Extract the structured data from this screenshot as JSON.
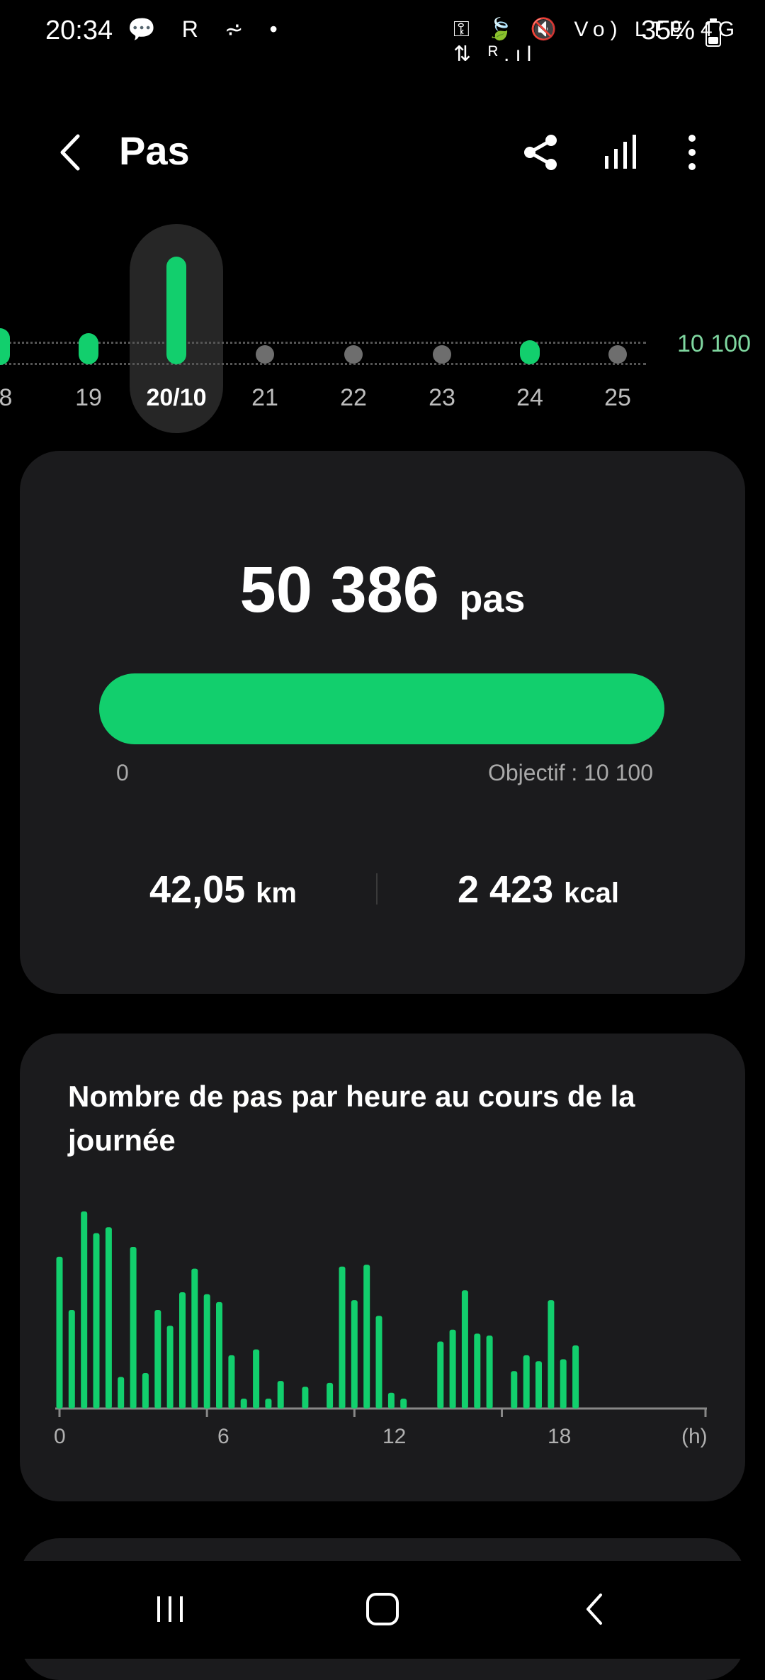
{
  "status_bar": {
    "time": "20:34",
    "left_icons_text": "💬 R ⩫ •",
    "right_icons_text": "⚿ 🍃 🔇 Vo) LTE 4G ⇅ ᴿ.ıl",
    "battery_pct": "35%"
  },
  "app_bar": {
    "title": "Pas",
    "icons": [
      "back-icon",
      "share-icon",
      "bar-chart-icon",
      "more-vertical-icon"
    ]
  },
  "week_strip": {
    "goal_label": "10 100",
    "days": [
      {
        "label": "8",
        "ratio": 0.3
      },
      {
        "label": "19",
        "ratio": 0.2
      },
      {
        "label": "20/10",
        "ratio": 1.0,
        "selected": true
      },
      {
        "label": "21",
        "ratio": 0
      },
      {
        "label": "22",
        "ratio": 0
      },
      {
        "label": "23",
        "ratio": 0
      },
      {
        "label": "24",
        "ratio": 0.15
      },
      {
        "label": "25",
        "ratio": 0
      }
    ]
  },
  "summary": {
    "steps_value": "50 386",
    "steps_unit": "pas",
    "progress_start": "0",
    "progress_goal": "Objectif : 10 100",
    "distance_value": "42,05",
    "distance_unit": "km",
    "calories_value": "2 423",
    "calories_unit": "kcal"
  },
  "hourly_chart": {
    "title": "Nombre de pas par heure au cours de la journée",
    "x_ticks": [
      "0",
      "6",
      "12",
      "18"
    ],
    "unit_label": "(h)"
  },
  "chart_data": {
    "type": "bar",
    "title": "Nombre de pas par heure au cours de la journée",
    "xlabel": "(h)",
    "x_ticks": [
      "0",
      "6",
      "12",
      "18"
    ],
    "xlim": [
      0,
      24
    ],
    "bars": [
      {
        "x": 0.0,
        "v": 0.77
      },
      {
        "x": 0.5,
        "v": 0.5
      },
      {
        "x": 1.0,
        "v": 1.0
      },
      {
        "x": 1.5,
        "v": 0.89
      },
      {
        "x": 2.0,
        "v": 0.92
      },
      {
        "x": 2.5,
        "v": 0.16
      },
      {
        "x": 3.0,
        "v": 0.82
      },
      {
        "x": 3.5,
        "v": 0.18
      },
      {
        "x": 4.0,
        "v": 0.5
      },
      {
        "x": 4.5,
        "v": 0.42
      },
      {
        "x": 5.0,
        "v": 0.59
      },
      {
        "x": 5.5,
        "v": 0.71
      },
      {
        "x": 6.0,
        "v": 0.58
      },
      {
        "x": 6.5,
        "v": 0.54
      },
      {
        "x": 7.0,
        "v": 0.27
      },
      {
        "x": 7.5,
        "v": 0.05
      },
      {
        "x": 8.0,
        "v": 0.3
      },
      {
        "x": 8.5,
        "v": 0.05
      },
      {
        "x": 9.0,
        "v": 0.14
      },
      {
        "x": 10.0,
        "v": 0.11
      },
      {
        "x": 11.0,
        "v": 0.13
      },
      {
        "x": 11.5,
        "v": 0.72
      },
      {
        "x": 12.0,
        "v": 0.55
      },
      {
        "x": 12.5,
        "v": 0.73
      },
      {
        "x": 13.0,
        "v": 0.47
      },
      {
        "x": 13.5,
        "v": 0.08
      },
      {
        "x": 14.0,
        "v": 0.05
      },
      {
        "x": 15.5,
        "v": 0.34
      },
      {
        "x": 16.0,
        "v": 0.4
      },
      {
        "x": 16.5,
        "v": 0.6
      },
      {
        "x": 17.0,
        "v": 0.38
      },
      {
        "x": 17.5,
        "v": 0.37
      },
      {
        "x": 18.5,
        "v": 0.19
      },
      {
        "x": 19.0,
        "v": 0.27
      },
      {
        "x": 19.5,
        "v": 0.24
      },
      {
        "x": 20.0,
        "v": 0.55
      },
      {
        "x": 20.5,
        "v": 0.25
      },
      {
        "x": 21.0,
        "v": 0.32
      }
    ]
  },
  "nav_bar": [
    "recent-apps-icon",
    "home-icon",
    "back-nav-icon"
  ]
}
